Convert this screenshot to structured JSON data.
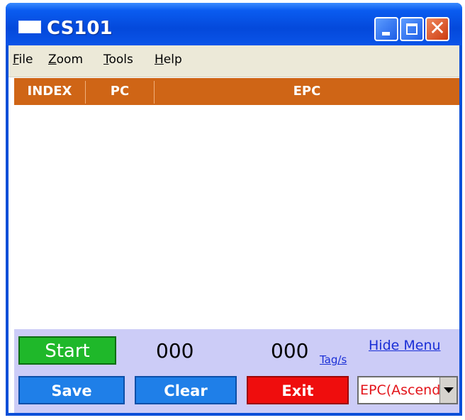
{
  "window": {
    "title": "CS101"
  },
  "menu": {
    "items": [
      {
        "label_acc": "F",
        "label_rest": "ile"
      },
      {
        "label_acc": "Z",
        "label_rest": "oom"
      },
      {
        "label_acc": "T",
        "label_rest": "ools"
      },
      {
        "label_acc": "H",
        "label_rest": "elp"
      }
    ]
  },
  "table": {
    "columns": [
      "INDEX",
      "PC",
      "EPC"
    ],
    "rows": []
  },
  "controls": {
    "start_label": "Start",
    "tag_count": "000",
    "rate_value": "000",
    "rate_unit": "Tag/s",
    "hide_menu_label": "Hide Menu",
    "save_label": "Save",
    "clear_label": "Clear",
    "exit_label": "Exit",
    "sort_value": "EPC(Ascending)"
  },
  "colors": {
    "title_bar": "#0a54e8",
    "header_bg": "#cf6516",
    "footer_bg": "#ccccf7",
    "start_btn": "#1fb82a",
    "action_btn": "#1f7fe8",
    "exit_btn": "#ef0d0d"
  },
  "icons": {
    "app": "window-icon",
    "minimize": "minimize-icon",
    "maximize": "maximize-icon",
    "close": "close-icon",
    "dropdown": "chevron-down-icon"
  }
}
